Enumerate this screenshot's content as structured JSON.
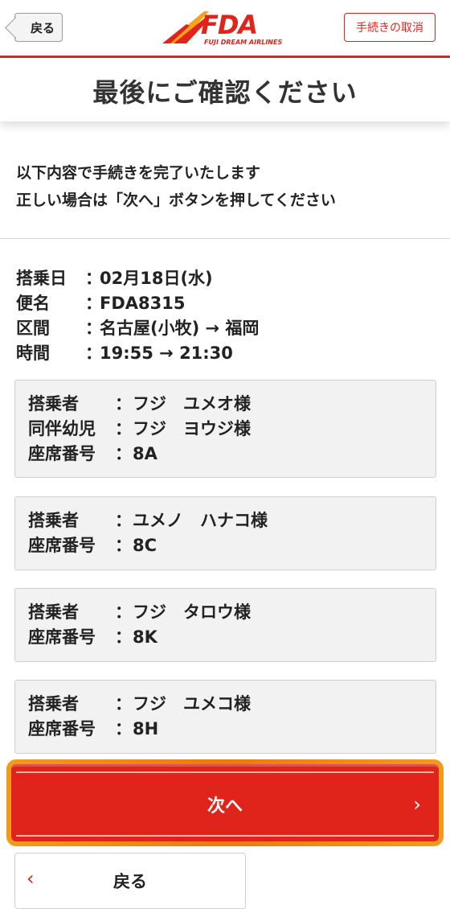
{
  "header": {
    "back_label": "戻る",
    "logo_text": "FDA",
    "logo_sub": "FUJI DREAM AIRLINES",
    "cancel_label": "手続きの取消"
  },
  "title": "最後にご確認ください",
  "intro": {
    "line1": "以下内容で手続きを完了いたします",
    "line2": "正しい場合は「次へ」ボタンを押してください"
  },
  "flight": {
    "date_label": "搭乗日",
    "date_value": "02月18日(水)",
    "flight_label": "便名",
    "flight_value": "FDA8315",
    "route_label": "区間",
    "route_value": "名古屋(小牧) → 福岡",
    "time_label": "時間",
    "time_value": "19:55 → 21:30"
  },
  "separator": "：",
  "passengers": [
    {
      "passenger_label": "搭乗者",
      "passenger_name": "フジ　ユメオ様",
      "infant_label": "同伴幼児",
      "infant_name": "フジ　ヨウジ様",
      "seat_label": "座席番号",
      "seat": "8A"
    },
    {
      "passenger_label": "搭乗者",
      "passenger_name": "ユメノ　ハナコ様",
      "seat_label": "座席番号",
      "seat": "8C"
    },
    {
      "passenger_label": "搭乗者",
      "passenger_name": "フジ　タロウ様",
      "seat_label": "座席番号",
      "seat": "8K"
    },
    {
      "passenger_label": "搭乗者",
      "passenger_name": "フジ　ユメコ様",
      "seat_label": "座席番号",
      "seat": "8H"
    }
  ],
  "buttons": {
    "next_label": "次へ",
    "next_chevron": "›",
    "back_label": "戻る",
    "back_chevron": "‹"
  },
  "colors": {
    "brand_red": "#e0241b",
    "highlight_orange": "#f39a1d",
    "card_bg": "#f2f2f2"
  }
}
